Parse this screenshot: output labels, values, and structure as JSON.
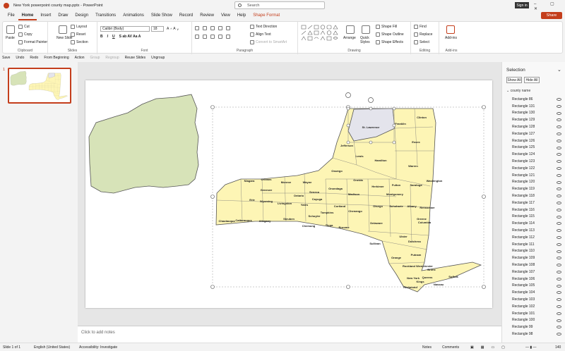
{
  "window": {
    "title": "New York powerpoint county map.pptx  -  PowerPoint",
    "signin": "Sign in",
    "controls": "–  ▢  ✕",
    "share": "Share"
  },
  "search": {
    "placeholder": "Search"
  },
  "tabs": [
    "File",
    "Home",
    "Insert",
    "Draw",
    "Design",
    "Transitions",
    "Animations",
    "Slide Show",
    "Record",
    "Review",
    "View",
    "Help",
    "Shape Format"
  ],
  "ribbon": {
    "clipboard": {
      "label": "Clipboard",
      "paste": "Paste",
      "cut": "Cut",
      "copy": "Copy",
      "format_painter": "Format Painter"
    },
    "slides": {
      "label": "Slides",
      "new_slide": "New Slide",
      "layout": "Layout",
      "reset": "Reset",
      "section": "Section"
    },
    "font": {
      "label": "Font",
      "name": "Calibri (Body)",
      "size": "18"
    },
    "paragraph": {
      "label": "Paragraph",
      "text_direction": "Text Direction",
      "align_text": "Align Text",
      "smartart": "Convert to SmartArt"
    },
    "drawing": {
      "label": "Drawing",
      "arrange": "Arrange",
      "quick_styles": "Quick Styles",
      "shape_fill": "Shape Fill",
      "shape_outline": "Shape Outline",
      "shape_effects": "Shape Effects"
    },
    "editing": {
      "label": "Editing",
      "find": "Find",
      "replace": "Replace",
      "select": "Select"
    },
    "addins": {
      "label": "Add-ins",
      "btn": "Add-ins"
    }
  },
  "qat": {
    "save": "Save",
    "undo": "Undo",
    "redo": "Redo",
    "from_beginning": "From Beginning",
    "action": "Action",
    "group": "Group",
    "regroup": "Regroup",
    "reuse": "Reuse Slides",
    "ungroup": "Ungroup"
  },
  "thumbs": {
    "slide_number": "1"
  },
  "notes": {
    "placeholder": "Click to add notes"
  },
  "selection": {
    "title": "Selection",
    "show_all": "Show All",
    "hide_all": "Hide All",
    "group": "county name",
    "items": [
      "Rectangle 86",
      "Rectangle 131",
      "Rectangle 130",
      "Rectangle 129",
      "Rectangle 128",
      "Rectangle 127",
      "Rectangle 126",
      "Rectangle 125",
      "Rectangle 124",
      "Rectangle 123",
      "Rectangle 122",
      "Rectangle 121",
      "Rectangle 120",
      "Rectangle 119",
      "Rectangle 118",
      "Rectangle 117",
      "Rectangle 116",
      "Rectangle 115",
      "Rectangle 114",
      "Rectangle 113",
      "Rectangle 112",
      "Rectangle 111",
      "Rectangle 110",
      "Rectangle 109",
      "Rectangle 108",
      "Rectangle 107",
      "Rectangle 106",
      "Rectangle 105",
      "Rectangle 104",
      "Rectangle 103",
      "Rectangle 102",
      "Rectangle 101",
      "Rectangle 100",
      "Rectangle 99",
      "Rectangle 98"
    ]
  },
  "status": {
    "slide": "Slide 1 of 1",
    "language": "English (United States)",
    "accessibility": "Accessibility: Investigate",
    "notes": "Notes",
    "comments": "Comments",
    "zoom": "140"
  },
  "map": {
    "counties": [
      "Clinton",
      "Franklin",
      "St. Lawrence",
      "Essex",
      "Jefferson",
      "Lewis",
      "Hamilton",
      "Warren",
      "Oswego",
      "Niagara",
      "Orleans",
      "Monroe",
      "Wayne",
      "Oneida",
      "Herkimer",
      "Fulton",
      "Saratoga",
      "Washington",
      "Genesee",
      "Ontario",
      "Seneca",
      "Onondaga",
      "Madison",
      "Montgomery",
      "Erie",
      "Wyoming",
      "Livingston",
      "Yates",
      "Cayuga",
      "Cortland",
      "Otsego",
      "Schoharie",
      "Albany",
      "Rensselaer",
      "Chenango",
      "Tompkins",
      "Schuyler",
      "Chautauqua",
      "Cattaraugus",
      "Allegany",
      "Steuben",
      "Chemung",
      "Tioga",
      "Broome",
      "Delaware",
      "Greene",
      "Columbia",
      "Ulster",
      "Dutchess",
      "Sullivan",
      "Orange",
      "Putnam",
      "Westchester",
      "Rockland",
      "Bronx",
      "New York",
      "Queens",
      "Kings",
      "Richmond",
      "Nassau",
      "Suffolk"
    ],
    "colors": {
      "county": "#fdf5b5",
      "selected": "#e4e4ec",
      "outline": "#555555",
      "state": "#d7e3b8"
    }
  }
}
